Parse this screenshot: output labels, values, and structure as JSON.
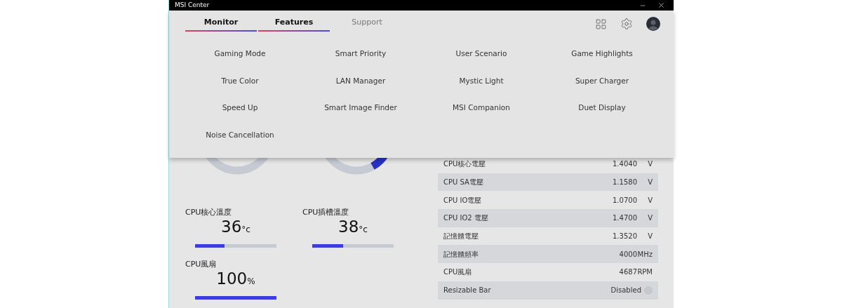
{
  "window": {
    "title": "MSI Center"
  },
  "tabs": [
    {
      "label": "Monitor",
      "selected": true
    },
    {
      "label": "Features",
      "selected": true
    },
    {
      "label": "Support",
      "selected": false
    }
  ],
  "features_menu": [
    "Gaming Mode",
    "Smart Priority",
    "User Scenario",
    "Game Highlights",
    "True Color",
    "LAN Manager",
    "Mystic Light",
    "Super Charger",
    "Speed Up",
    "Smart Image Finder",
    "MSI Companion",
    "Duet Display",
    "Noise Cancellation"
  ],
  "metrics": [
    {
      "label": "CPU核心溫度",
      "value": "36",
      "unit": "°c",
      "level": 0.36
    },
    {
      "label": "CPU插槽溫度",
      "value": "38",
      "unit": "°c",
      "level": 0.38
    },
    {
      "label": "CPU風扇",
      "value": "100",
      "unit": "%",
      "level": 1
    }
  ],
  "readings": [
    {
      "name": "CPU核心電壓",
      "value": "1.4040",
      "unit": "V"
    },
    {
      "name": "CPU SA電壓",
      "value": "1.1580",
      "unit": "V"
    },
    {
      "name": "CPU IO電壓",
      "value": "1.0700",
      "unit": "V"
    },
    {
      "name": "CPU IO2 電壓",
      "value": "1.4700",
      "unit": "V"
    },
    {
      "name": "記憶體電壓",
      "value": "1.3520",
      "unit": "V"
    },
    {
      "name": "記憶體頻率",
      "value": "4000",
      "unit": "MHz"
    },
    {
      "name": "CPU風扇",
      "value": "4687",
      "unit": "RPM"
    },
    {
      "name": "Resizable Bar",
      "value": "Disabled",
      "help": true
    }
  ]
}
